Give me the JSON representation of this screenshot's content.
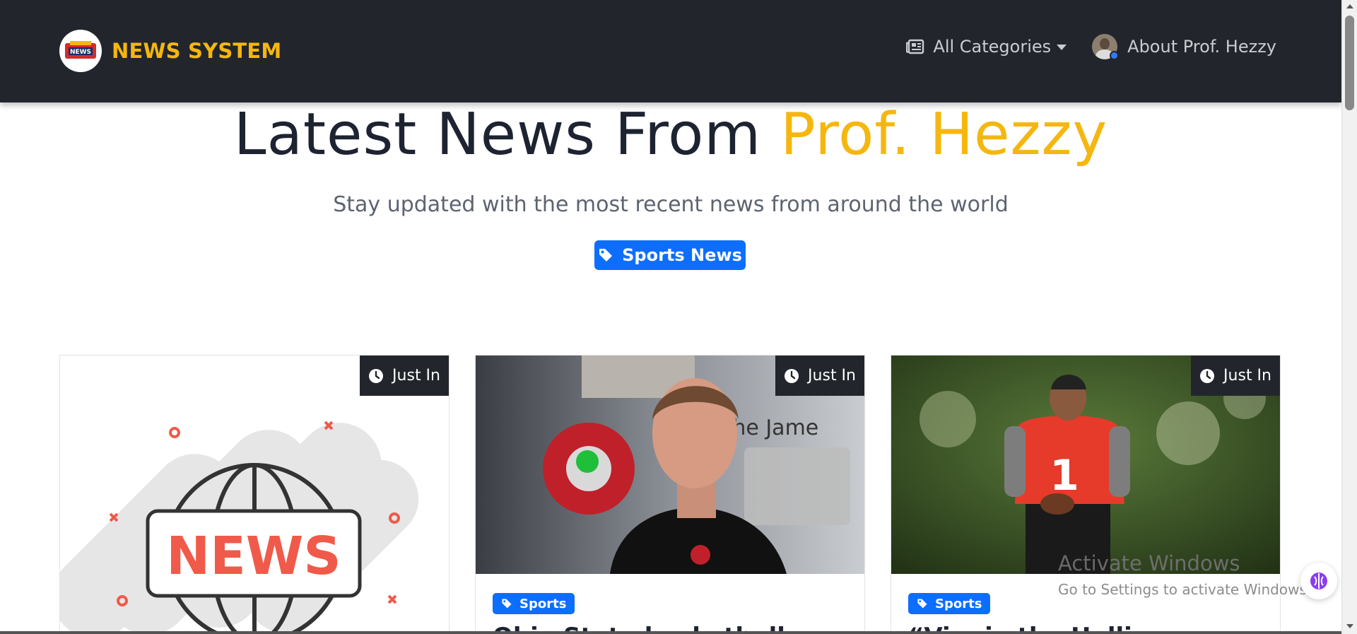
{
  "navbar": {
    "brand_name": "NEWS SYSTEM",
    "categories_label": "All Categories",
    "about_label": "About Prof. Hezzy"
  },
  "hero": {
    "title_main": "Latest News From ",
    "title_accent": "Prof. Hezzy",
    "subtitle": "Stay updated with the most recent news from around the world",
    "tag_label": "Sports News"
  },
  "cards": [
    {
      "badge": "Just In",
      "image": "news-placeholder",
      "category": "",
      "title": ""
    },
    {
      "badge": "Just In",
      "image": "coach-photo",
      "category": "Sports",
      "title": "Ohio State basketball"
    },
    {
      "badge": "Just In",
      "image": "football-player-photo",
      "category": "Sports",
      "title": "“Vinnie the Hollie"
    }
  ],
  "watermark": {
    "line1": "Activate Windows",
    "line2": "Go to Settings to activate Windows."
  },
  "colors": {
    "navbar_bg": "#22262c",
    "brand": "#f5b70f",
    "primary": "#0d6efd",
    "title": "#1d2331"
  }
}
